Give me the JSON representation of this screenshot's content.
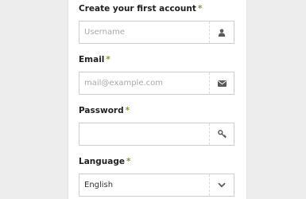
{
  "form": {
    "required_mark": "*",
    "fields": [
      {
        "label": "Create your first account",
        "placeholder": "Username",
        "icon": "user-icon"
      },
      {
        "label": "Email",
        "placeholder": "mail@example.com",
        "icon": "envelope-icon"
      },
      {
        "label": "Password",
        "placeholder": "",
        "icon": "key-icon"
      },
      {
        "label": "Language",
        "value": "English",
        "icon": "chevron-down-icon"
      }
    ]
  },
  "colors": {
    "accent": "#7da021",
    "icon": "#5a5a5a",
    "border": "#cfcfcf"
  }
}
